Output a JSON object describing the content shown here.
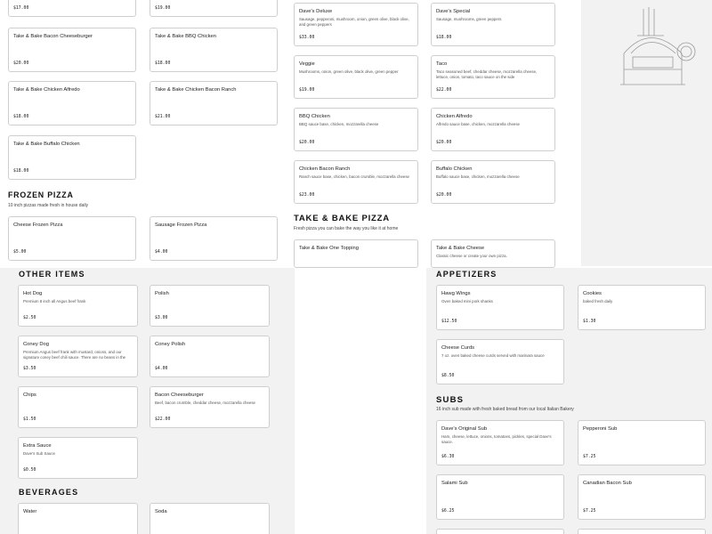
{
  "top_prices": [
    "$17.00",
    "$19.00"
  ],
  "take_bake_left": [
    {
      "title": "Take & Bake Bacon Cheeseburger",
      "price": "$20.00"
    },
    {
      "title": "Take & Bake BBQ Chicken",
      "price": "$18.00"
    },
    {
      "title": "Take & Bake Chicken Alfredo",
      "price": "$18.00"
    },
    {
      "title": "Take & Bake Chicken Bacon Ranch",
      "price": "$21.00"
    },
    {
      "title": "Take & Bake Buffalo Chicken",
      "price": "$18.00"
    }
  ],
  "frozen": {
    "title": "FROZEN PIZZA",
    "subtitle": "10 inch pizzas made fresh in house daily",
    "items": [
      {
        "title": "Cheese Frozen Pizza",
        "price": "$5.00"
      },
      {
        "title": "Sausage Frozen Pizza",
        "price": "$4.00"
      }
    ]
  },
  "pizzas": [
    {
      "title": "Dave's Deluxe",
      "desc": "Sausage, pepperoni, mushroom, onion, green olive, black olive, and green peppers",
      "price": "$33.00"
    },
    {
      "title": "Dave's Special",
      "desc": "Sausage, mushrooms, green peppers",
      "price": "$18.00"
    },
    {
      "title": "Veggie",
      "desc": "Mushrooms, onion, green olive, black olive, green pepper",
      "price": "$19.00"
    },
    {
      "title": "Taco",
      "desc": "Taco seasoned beef, cheddar cheese, mozzarella cheese, lettuce, onion, tomato, taco sauce on the side",
      "price": "$22.00"
    },
    {
      "title": "BBQ Chicken",
      "desc": "BBQ sauce base, chicken, mozzarella cheese",
      "price": "$20.00"
    },
    {
      "title": "Chicken Alfredo",
      "desc": "Alfredo sauce base, chicken, mozzarella cheese",
      "price": "$20.00"
    },
    {
      "title": "Chicken Bacon Ranch",
      "desc": "Ranch sauce base, chicken, bacon crumble, mozzarella cheese",
      "price": "$23.00"
    },
    {
      "title": "Buffalo Chicken",
      "desc": "Buffalo sauce base, chicken, mozzarella cheese",
      "price": "$20.00"
    }
  ],
  "take_bake": {
    "title": "TAKE & BAKE PIZZA",
    "subtitle": "Fresh pizza you can bake the way you like it at home",
    "items": [
      {
        "title": "Take & Bake One Topping",
        "desc": ""
      },
      {
        "title": "Take & Bake Cheese",
        "desc": "Classic cheese or create your own pizza."
      }
    ]
  },
  "other": {
    "title": "OTHER ITEMS",
    "items": [
      {
        "title": "Hot Dog",
        "desc": "Premium 8 inch all Angus beef frank",
        "price": "$2.50"
      },
      {
        "title": "Polish",
        "desc": "",
        "price": "$3.00"
      },
      {
        "title": "Coney Dog",
        "desc": "Premium Angus beef frank with mustard, onions, and our signature coney beef chili sauce. There are no beans in the",
        "price": "$3.50"
      },
      {
        "title": "Coney Polish",
        "desc": "",
        "price": "$4.00"
      },
      {
        "title": "Chips",
        "desc": "",
        "price": "$1.50"
      },
      {
        "title": "Bacon Cheeseburger",
        "desc": "Beef, bacon crumble, cheddar cheese, mozzarella cheese",
        "price": "$22.00"
      },
      {
        "title": "Extra Sauce",
        "desc": "Dave's Sub Sauce",
        "price": "$0.50"
      }
    ]
  },
  "beverages": {
    "title": "BEVERAGES",
    "items": [
      {
        "title": "Water"
      },
      {
        "title": "Soda"
      }
    ]
  },
  "appetizers": {
    "title": "APPETIZERS",
    "items": [
      {
        "title": "Hawg Wings",
        "desc": "Oven baked mini pork shanks",
        "price": "$12.50"
      },
      {
        "title": "Cookies",
        "desc": "baked fresh daily",
        "price": "$1.30"
      },
      {
        "title": "Cheese Curds",
        "desc": "7 oz. oven baked cheese curds served with marinara sauce",
        "price": "$8.50"
      }
    ]
  },
  "subs": {
    "title": "SUBS",
    "subtitle": "16 inch sub made with fresh baked bread from our local Italian Bakery",
    "items": [
      {
        "title": "Dave's Original Sub",
        "desc": "Ham, cheese, lettuce, onions, tomatoes, pickles, special Dave's sauce.",
        "price": "$6.30"
      },
      {
        "title": "Pepperoni Sub",
        "desc": "",
        "price": "$7.25"
      },
      {
        "title": "Salami Sub",
        "desc": "",
        "price": "$6.25"
      },
      {
        "title": "Canadian Bacon Sub",
        "desc": "",
        "price": "$7.25"
      }
    ]
  }
}
